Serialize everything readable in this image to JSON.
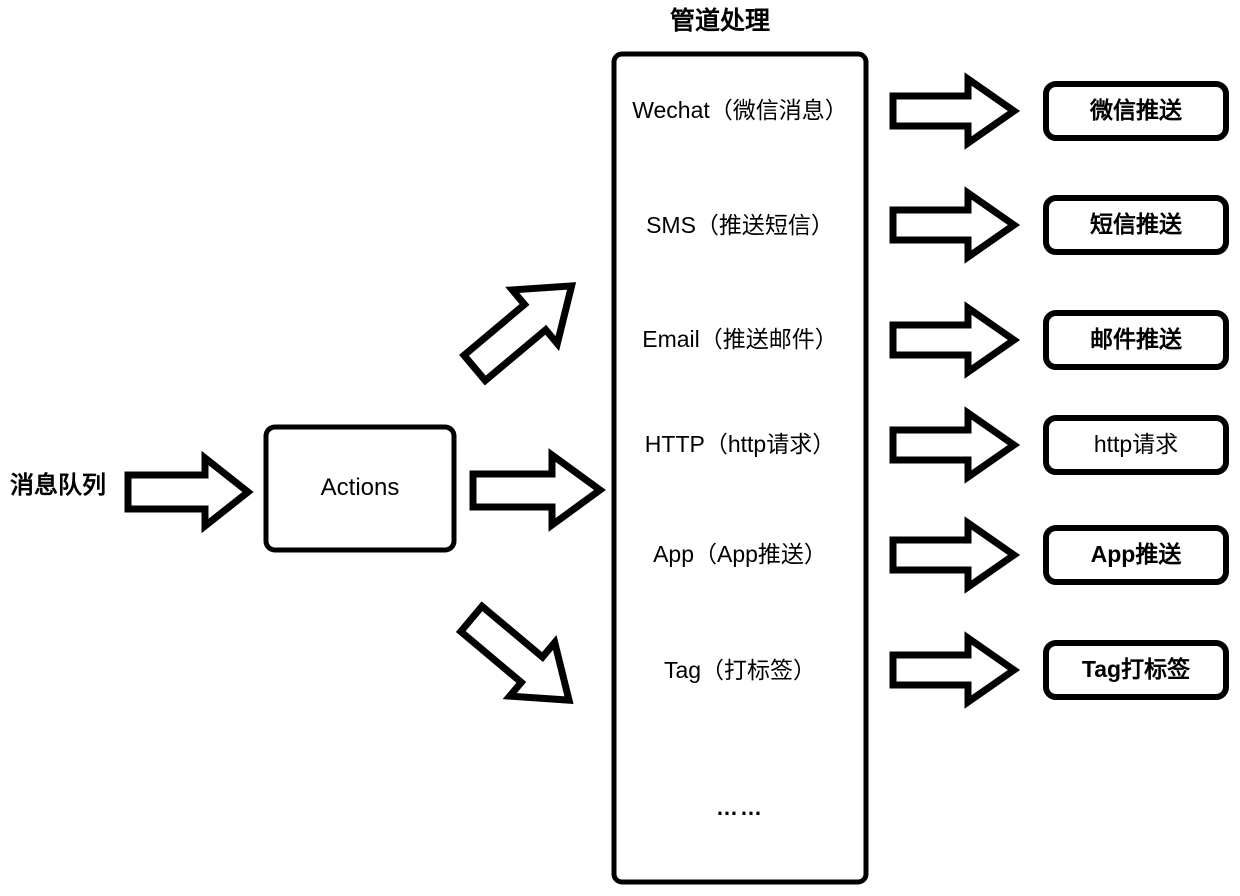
{
  "diagram": {
    "title": "管道处理",
    "source_label": "消息队列",
    "actions_label": "Actions",
    "pipeline_ellipsis": "……",
    "pipeline_items": [
      {
        "label": "Wechat（微信消息）",
        "output": "微信推送"
      },
      {
        "label": "SMS（推送短信）",
        "output": "短信推送"
      },
      {
        "label": "Email（推送邮件）",
        "output": "邮件推送"
      },
      {
        "label": "HTTP（http请求）",
        "output": "http请求"
      },
      {
        "label": "App（App推送）",
        "output": "App推送"
      },
      {
        "label": "Tag（打标签）",
        "output": "Tag打标签"
      }
    ],
    "colors": {
      "stroke": "#000000",
      "fill": "#ffffff",
      "background": "#ffffff"
    }
  }
}
